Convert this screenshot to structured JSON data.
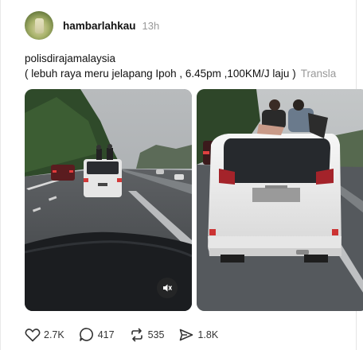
{
  "post": {
    "username": "hambarlahkau",
    "time": "13h",
    "caption_line1": "polisdirajamalaysia",
    "caption_line2": "( lebuh raya meru jelapang Ipoh , 6.45pm ,100KM/J laju )",
    "translate_label": "Transla"
  },
  "media": [
    {
      "icon": "mute-icon"
    },
    {
      "icon": ""
    }
  ],
  "actions": {
    "likes": "2.7K",
    "comments": "417",
    "reposts": "535",
    "shares": "1.8K"
  }
}
